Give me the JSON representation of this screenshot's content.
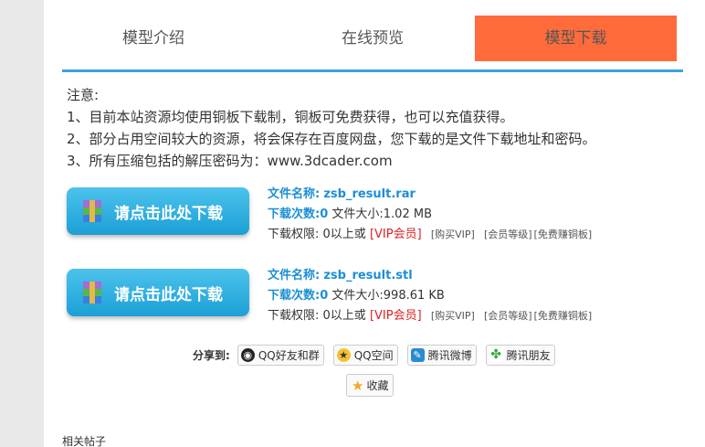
{
  "tabs": [
    {
      "label": "模型介绍"
    },
    {
      "label": "在线预览"
    },
    {
      "label": "模型下载"
    }
  ],
  "notice": {
    "title": "注意:",
    "lines": [
      "1、目前本站资源均使用铜板下载制，铜板可免费获得，也可以充值获得。",
      "2、部分占用空间较大的资源，将会保存在百度网盘，您下载的是文件下载地址和密码。",
      "3、所有压缩包括的解压密码为：www.3dcader.com"
    ]
  },
  "downloads": [
    {
      "button": "请点击此处下载",
      "filename_label": "文件名称:",
      "filename": "zsb_result.rar",
      "count_label": "下载次数:",
      "count": "0",
      "size_label": "文件大小:",
      "size": "1.02 MB",
      "perm_label": "下载权限:",
      "perm_value": "0以上或",
      "vip": "[VIP会员]",
      "link_buy": "[购买VIP]",
      "link_level": "[会员等级]",
      "link_free": "[免费赚铜板]"
    },
    {
      "button": "请点击此处下载",
      "filename_label": "文件名称:",
      "filename": "zsb_result.stl",
      "count_label": "下载次数:",
      "count": "0",
      "size_label": "文件大小:",
      "size": "998.61 KB",
      "perm_label": "下载权限:",
      "perm_value": "0以上或",
      "vip": "[VIP会员]",
      "link_buy": "[购买VIP]",
      "link_level": "[会员等级]",
      "link_free": "[免费赚铜板]"
    }
  ],
  "share": {
    "label": "分享到:",
    "buttons": [
      {
        "label": "QQ好友和群"
      },
      {
        "label": "QQ空间"
      },
      {
        "label": "腾讯微博"
      },
      {
        "label": "腾讯朋友"
      }
    ],
    "favorite": "收藏"
  },
  "related": "相关帖子",
  "colors": {
    "active_tab": "#ff6b3b",
    "tab_underline": "#3aa3dd",
    "download_button": "#1c9fd6",
    "info_blue": "#1b8fd4",
    "vip_red": "#dd2222"
  }
}
